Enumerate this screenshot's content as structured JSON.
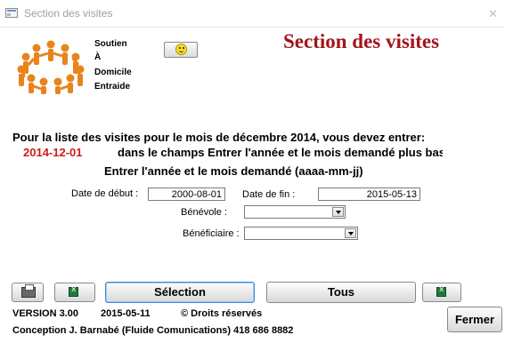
{
  "window": {
    "title": "Section des visites",
    "close_glyph": "✕",
    "app_icon": "form-icon"
  },
  "org": {
    "lines": [
      "Soutien",
      "À",
      "Domicile",
      "Entraide"
    ],
    "logo": "people-circle-logo"
  },
  "header": {
    "title": "Section des visites",
    "smiley_icon": "smiley-icon"
  },
  "instructions": {
    "line1": "Pour la liste des visites pour le mois de décembre 2014, vous devez entrer:",
    "example": "2014-12-01",
    "line2": "dans le champs Entrer l'année et le mois demandé plus bas",
    "line3": "Entrer l'année et le mois demandé (aaaa-mm-jj)"
  },
  "form": {
    "start_label": "Date de début :",
    "start_value": "2000-08-01",
    "end_label": "Date de fin :",
    "end_value": "2015-05-13",
    "volunteer_label": "Bénévole :",
    "volunteer_value": "",
    "beneficiary_label": "Bénéficiaire :",
    "beneficiary_value": ""
  },
  "actions": {
    "selection_label": "Sélection",
    "all_label": "Tous",
    "print_icon": "printer-icon",
    "excel_icon": "excel-icon"
  },
  "footer": {
    "version": "VERSION 3.00",
    "date": "2015-05-11",
    "rights": "© Droits réservés",
    "credits": "Conception J. Barnabé (Fluide Comunications) 418 686 8882",
    "close_label": "Fermer"
  },
  "colors": {
    "title_red": "#a3141a",
    "example_red": "#d11a1a",
    "focus_blue": "#3c8ad6",
    "logo_orange": "#e8841c"
  }
}
